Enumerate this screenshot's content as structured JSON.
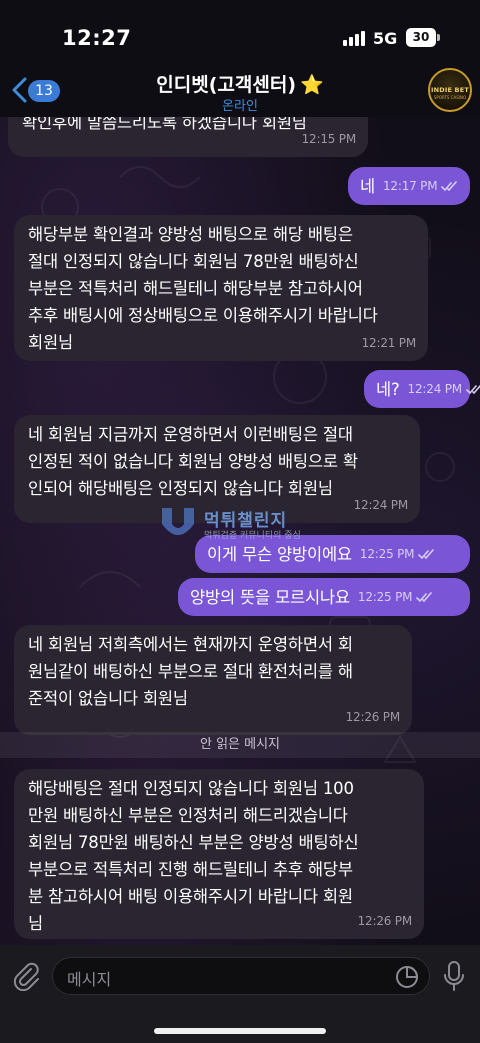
{
  "status_bar": {
    "time": "12:27",
    "network": "5G",
    "battery": "30"
  },
  "header": {
    "back_badge": "13",
    "title": "인디벳(고객센터)",
    "star": "⭐",
    "subtitle": "온라인",
    "avatar_text": "INDIE BET",
    "avatar_subtext": "SPORTS CASINO"
  },
  "watermark": {
    "title": "먹튀챌린지",
    "subtitle": "먹튀검증 커뮤니티의 중심"
  },
  "messages": [
    {
      "direction": "in",
      "text": "확인후에 말씀드리도록 하겠습니다 회원님",
      "time": "12:15 PM"
    },
    {
      "direction": "out",
      "text": "네",
      "time": "12:17 PM",
      "read": true
    },
    {
      "direction": "in",
      "text": "해당부분 확인결과 양방성 배팅으로 해당 배팅은\n절대 인정되지 않습니다 회원님 78만원 배팅하신\n부분은 적특처리 해드릴테니 해당부분 참고하시어\n추후 배팅시에 정상배팅으로 이용해주시기 바랍니다\n회원님",
      "time": "12:21 PM"
    },
    {
      "direction": "out",
      "text": "네?",
      "time": "12:24 PM",
      "read": true
    },
    {
      "direction": "in",
      "text": "네 회원님 지금까지 운영하면서 이런배팅은 절대\n인정된 적이 없습니다 회원님 양방성 배팅으로 확\n인되어 해당배팅은 인정되지 않습니다 회원님",
      "time": "12:24 PM"
    },
    {
      "direction": "out",
      "text": "이게 무슨 양방이에요",
      "time": "12:25 PM",
      "read": true
    },
    {
      "direction": "out",
      "text": "양방의 뜻을 모르시나요",
      "time": "12:25 PM",
      "read": true
    },
    {
      "direction": "in",
      "text": "네 회원님 저희측에서는 현재까지 운영하면서 회\n원님같이 배팅하신 부분으로 절대 환전처리를 해\n준적이 없습니다 회원님",
      "time": "12:26 PM"
    },
    {
      "direction": "in",
      "text": "해당배팅은 절대 인정되지 않습니다 회원님 100\n만원 배팅하신 부분은 인정처리 해드리겠습니다\n회원님 78만원 배팅하신 부분은 양방성 배팅하신\n부분으로 적특처리 진행 해드릴테니 추후 해당부\n분 참고하시어 배팅 이용해주시기 바랍니다 회원\n님",
      "time": "12:26 PM"
    }
  ],
  "unread_divider": "안 읽은 메시지",
  "input": {
    "placeholder": "메시지"
  },
  "colors": {
    "outgoing": "#7a56d6",
    "incoming": "#2a2530",
    "accent": "#3d8ddb"
  },
  "icons": [
    "back-chevron-icon",
    "star-icon",
    "attach-icon",
    "sticker-icon",
    "mic-icon",
    "double-check-icon",
    "signal-icon",
    "battery-icon"
  ]
}
